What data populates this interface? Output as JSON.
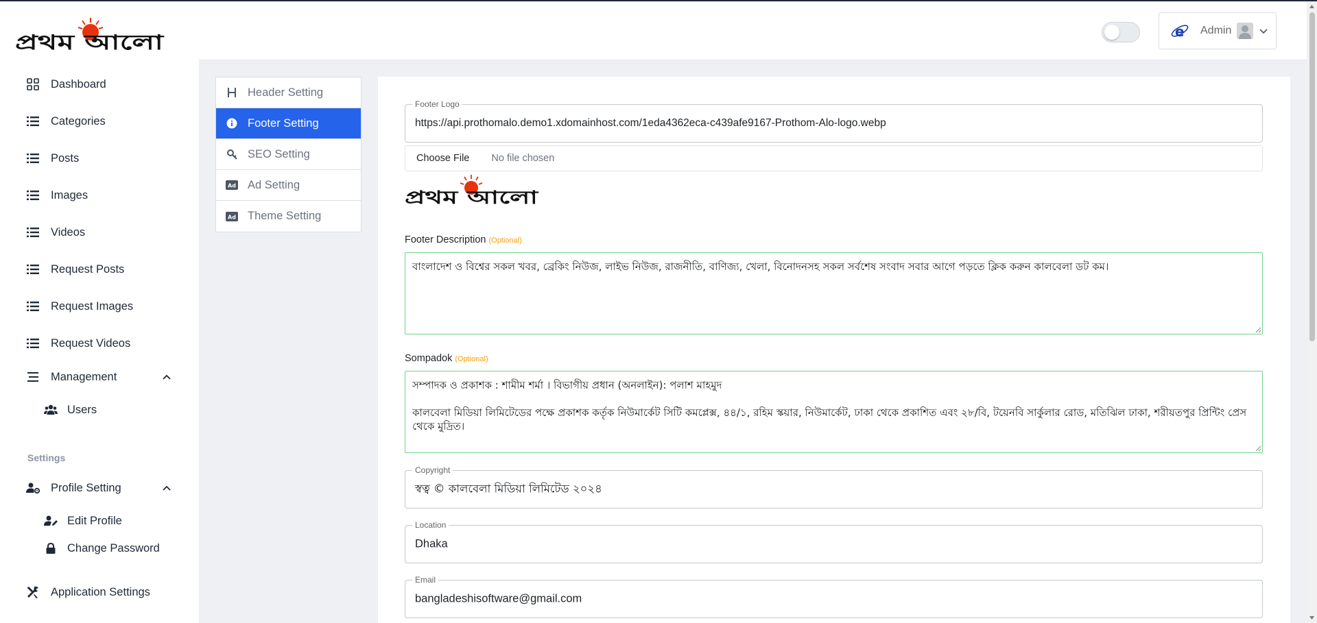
{
  "brand": {
    "logo_text": "প্রথম আলো"
  },
  "sidebar": {
    "items": [
      {
        "label": "Dashboard",
        "icon": "grid-icon"
      },
      {
        "label": "Categories",
        "icon": "list-icon"
      },
      {
        "label": "Posts",
        "icon": "list-icon"
      },
      {
        "label": "Images",
        "icon": "list-icon"
      },
      {
        "label": "Videos",
        "icon": "list-icon"
      },
      {
        "label": "Request Posts",
        "icon": "list-icon"
      },
      {
        "label": "Request Images",
        "icon": "list-icon"
      },
      {
        "label": "Request Videos",
        "icon": "list-icon"
      }
    ],
    "management": {
      "label": "Management",
      "sub": {
        "users": "Users"
      }
    },
    "settings_title": "Settings",
    "profile_setting": {
      "label": "Profile Setting",
      "edit_profile": "Edit Profile",
      "change_password": "Change Password"
    },
    "application_settings": "Application Settings"
  },
  "topbar": {
    "user_name": "Admin",
    "dark_mode_on": false
  },
  "tabs": [
    {
      "label": "Header Setting",
      "icon": "heading-icon",
      "active": false
    },
    {
      "label": "Footer Setting",
      "icon": "info-icon",
      "active": true
    },
    {
      "label": "SEO Setting",
      "icon": "search-key-icon",
      "active": false
    },
    {
      "label": "Ad Setting",
      "icon": "ad-icon",
      "active": false
    },
    {
      "label": "Theme Setting",
      "icon": "ad-icon",
      "active": false
    }
  ],
  "form": {
    "footer_logo": {
      "label": "Footer Logo",
      "value": "https://api.prothomalo.demo1.xdomainhost.com/1eda4362eca-c439afe9167-Prothom-Alo-logo.webp"
    },
    "file": {
      "button": "Choose File",
      "status": "No file chosen"
    },
    "footer_description": {
      "label": "Footer Description",
      "optional": "(Optional)",
      "value": "বাংলাদেশ ও বিশ্বের সকল খবর, ব্রেকিং নিউজ, লাইভ নিউজ, রাজনীতি, বাণিজ্য, খেলা, বিনোদনসহ সকল সর্বশেষ সংবাদ সবার আগে পড়তে ক্লিক করুন কালবেলা ডট কম।"
    },
    "sompadok": {
      "label": "Sompadok",
      "optional": "(Optional)",
      "line1": "সম্পাদক ও প্রকাশক : শামীম শর্মা । বিভাগীয় প্রধান (অনলাইন): পলাশ মাহমুদ",
      "line2": "কালবেলা মিডিয়া লিমিটেডের পক্ষে প্রকাশক কর্তৃক নিউমার্কেট সিটি কমপ্লেক্স, ৪৪/১, রহিম স্কয়ার, নিউমার্কেট, ঢাকা থেকে প্রকাশিত এবং ২৮/বি, টয়েনবি সার্কুলার রোড, মতিঝিল ঢাকা, শরীয়তপুর প্রিন্টিং প্রেস থেকে মুদ্রিত।"
    },
    "copyright": {
      "label": "Copyright",
      "value": "স্বত্ব © কালবেলা মিডিয়া লিমিটেড ২০২৪"
    },
    "location": {
      "label": "Location",
      "value": "Dhaka"
    },
    "email": {
      "label": "Email",
      "value": "bangladeshisoftware@gmail.com"
    }
  }
}
